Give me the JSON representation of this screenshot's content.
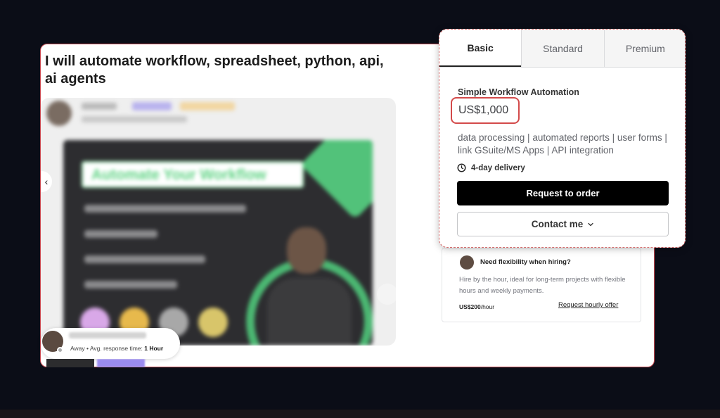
{
  "gig": {
    "title": "I will automate workflow, spreadsheet, python, api, ai agents"
  },
  "gallery": {
    "promo_headline": "Automate Your Workflow",
    "prev_arrow": "‹"
  },
  "seller_status": {
    "availability": "Away",
    "separator": "•",
    "response_label": "Avg. response time:",
    "response_value": "1 Hour"
  },
  "pricing": {
    "tabs": [
      {
        "label": "Basic",
        "active": true
      },
      {
        "label": "Standard",
        "active": false
      },
      {
        "label": "Premium",
        "active": false
      }
    ],
    "package_title": "Simple Workflow Automation",
    "price": "US$1,000",
    "description": "data processing | automated reports | user forms | link GSuite/MS Apps | API integration",
    "delivery": "4-day delivery",
    "order_button": "Request to order",
    "contact_button": "Contact me",
    "contact_icon": "chevron-down-icon"
  },
  "hourly": {
    "title": "Need flexibility when hiring?",
    "description": "Hire by the hour, ideal for long-term projects with flexible hours and weekly payments.",
    "rate": "US$200",
    "rate_unit": "/hour",
    "link": "Request hourly offer"
  },
  "colors": {
    "background": "#0b0d17",
    "highlight": "#d34a4a",
    "order_button": "#000000",
    "promo_green": "#52c27a"
  }
}
